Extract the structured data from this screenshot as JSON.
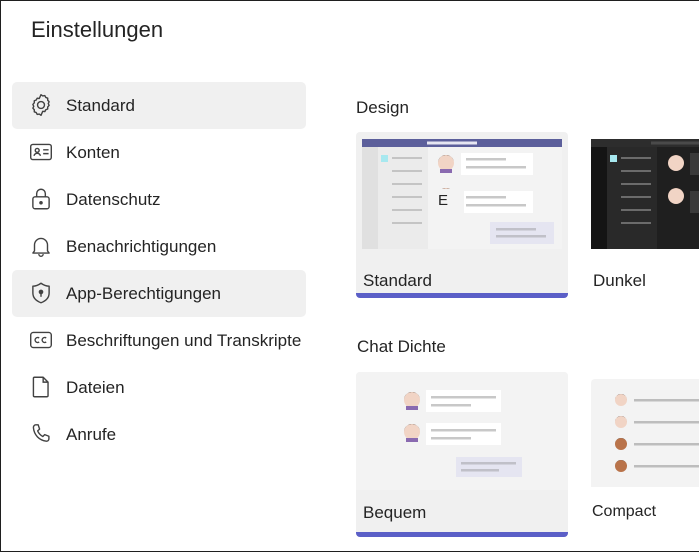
{
  "page": {
    "title": "Einstellungen"
  },
  "sidebar": {
    "items": [
      {
        "label": "Standard",
        "icon": "gear-icon",
        "highlighted": true
      },
      {
        "label": "Konten",
        "icon": "contact-card-icon"
      },
      {
        "label": "Datenschutz",
        "icon": "lock-icon"
      },
      {
        "label": "Benachrichtigungen",
        "icon": "bell-icon"
      },
      {
        "label": "App-Berechtigungen",
        "icon": "shield-icon",
        "highlighted": true
      },
      {
        "label": "Beschriftungen und Transkripte",
        "icon": "closed-captions-icon"
      },
      {
        "label": "Dateien",
        "icon": "document-icon"
      },
      {
        "label": "Anrufe",
        "icon": "phone-icon"
      }
    ]
  },
  "design": {
    "section_label": "Design",
    "themes": [
      {
        "label": "Standard",
        "preview_letter": "E",
        "selected": true
      },
      {
        "label": "Dunkel",
        "selected": false
      }
    ]
  },
  "chat_density": {
    "section_label": "Chat Dichte",
    "options": [
      {
        "label": "Bequem",
        "selected": true
      },
      {
        "label": "Compact",
        "selected": false
      }
    ]
  },
  "colors": {
    "accent": "#5b5fc7",
    "highlight": "#f0f0f0",
    "text": "#242424"
  }
}
